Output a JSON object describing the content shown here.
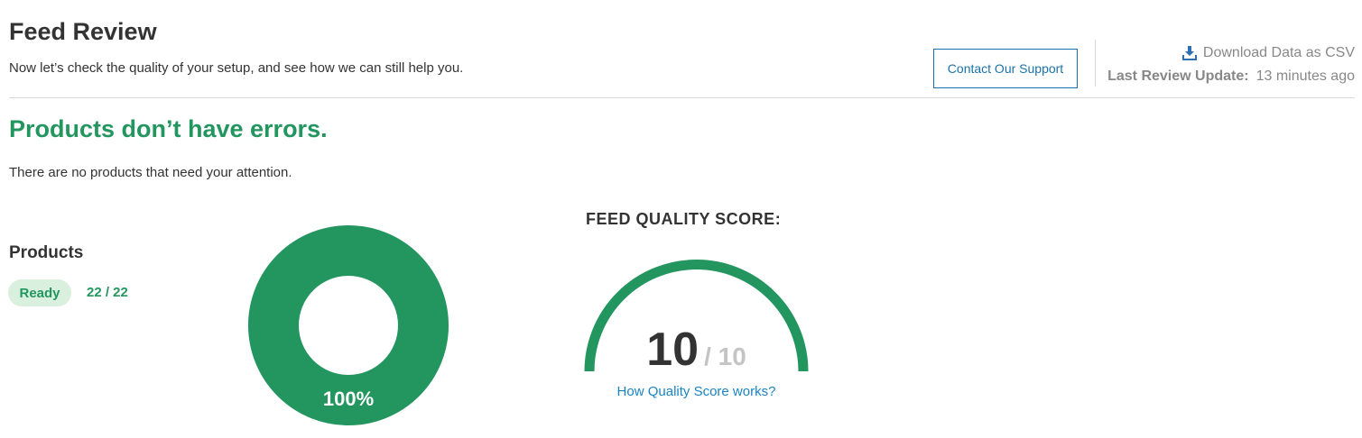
{
  "header": {
    "title": "Feed Review",
    "subtitle": "Now let’s check the quality of your setup, and see how we can still help you.",
    "support_button": "Contact Our Support",
    "download_label": "Download Data as CSV",
    "last_update_label": "Last Review Update:",
    "last_update_value": "13 minutes ago"
  },
  "status": {
    "heading": "Products don’t have errors.",
    "text": "There are no products that need your attention."
  },
  "products": {
    "heading": "Products",
    "badge": "Ready",
    "count": "22 / 22",
    "donut_percent_label": "100%",
    "ready_fraction": 1.0
  },
  "score": {
    "heading": "FEED QUALITY SCORE:",
    "value": "10",
    "out_of": "/ 10",
    "fraction": 1.0,
    "link": "How Quality Score works?"
  },
  "colors": {
    "brand_green": "#23965f",
    "badge_bg": "#d9f0df",
    "link_blue": "#1a84c2",
    "button_blue": "#1a73a8",
    "muted_gray": "#888888"
  },
  "icons": {
    "download": "download-icon"
  }
}
